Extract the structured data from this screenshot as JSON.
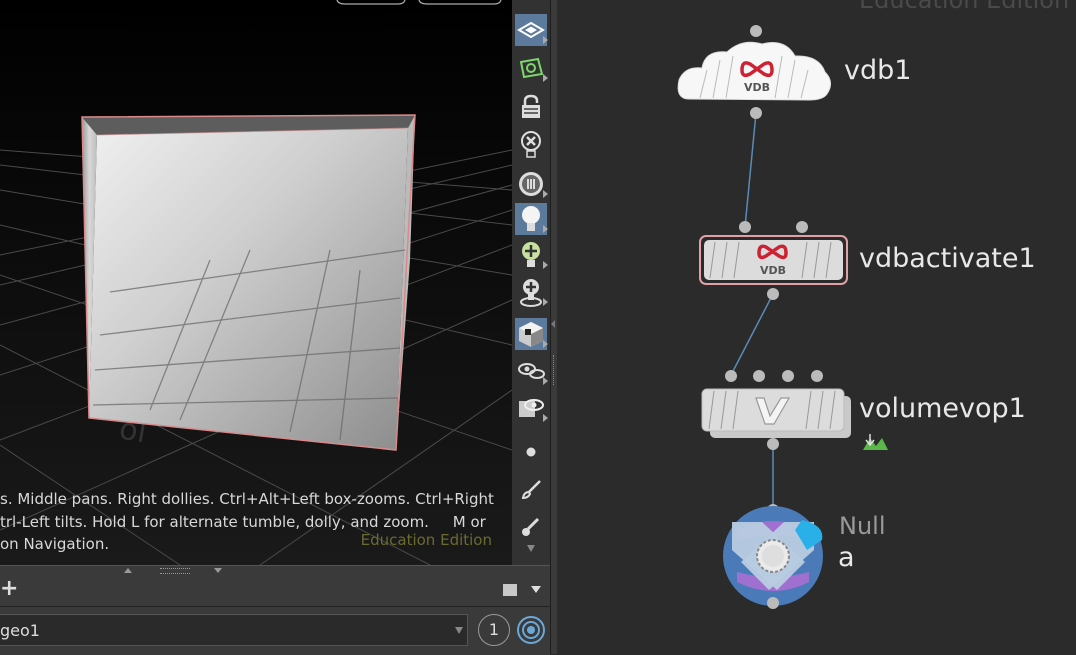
{
  "viewport": {
    "help_line1": "s. Middle pans. Right dollies. Ctrl+Alt+Left box-zooms. Ctrl+Right",
    "help_line2": "trl-Left tilts. Hold L for alternate tumble, dolly, and zoom.     M or",
    "help_line3": "on Navigation.",
    "edition_label": "Education Edition"
  },
  "toolbar": {
    "tools": [
      "display-options-icon",
      "ghost-icon",
      "lock-icon",
      "remove-light-icon",
      "headlight-icon",
      "light-icon",
      "add-light-icon",
      "add-light-on-target-icon",
      "shading-icon",
      "eyes-icon",
      "visibility-icon",
      "point-icon",
      "brush-icon",
      "pick-icon"
    ]
  },
  "bottom": {
    "path_value": "geo1",
    "count_value": "1"
  },
  "network": {
    "edition_label": "Education Edition",
    "nodes": [
      {
        "name": "vdb1",
        "badge": "VDB"
      },
      {
        "name": "vdbactivate1",
        "badge": "VDB"
      },
      {
        "name": "volumevop1",
        "badge": "V"
      },
      {
        "name": "a",
        "type": "Null"
      }
    ],
    "colors": {
      "selected_outline": "#e0a0a6",
      "null_blue": "#4a7ab8",
      "null_purple": "#a070d0",
      "cyan": "#2ab0e8",
      "vdb_red": "#cc2233"
    }
  }
}
